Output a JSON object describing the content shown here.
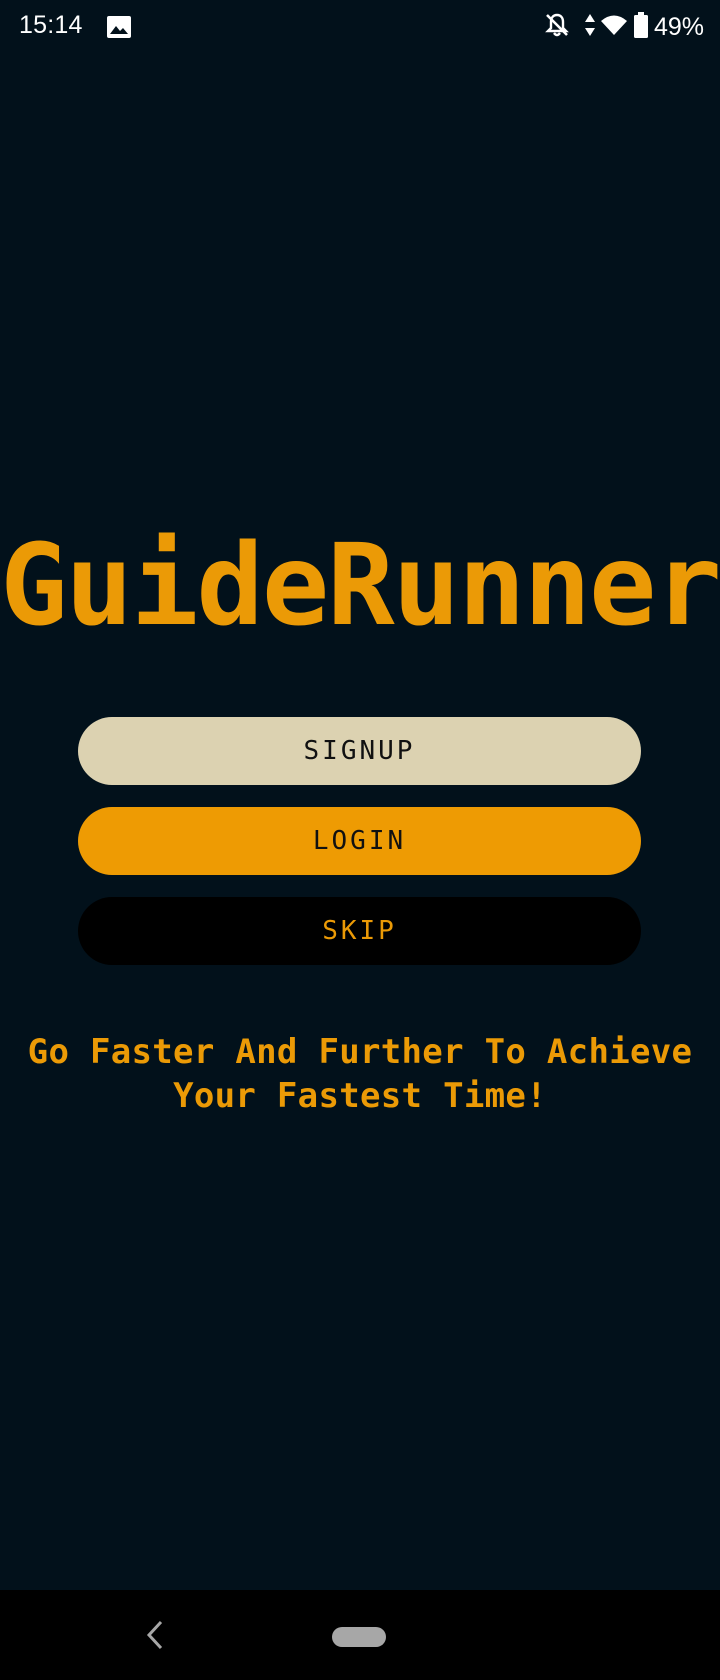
{
  "status_bar": {
    "time": "15:14",
    "battery_percent": "49%",
    "icons": [
      "gallery-icon",
      "notifications-off-icon",
      "data-arrows-icon",
      "wifi-icon",
      "battery-icon"
    ]
  },
  "app": {
    "title": "GuideRunner",
    "tagline": "Go Faster And Further To Achieve Your Fastest Time!"
  },
  "buttons": {
    "signup": "SIGNUP",
    "login": "LOGIN",
    "skip": "SKIP"
  },
  "colors": {
    "background": "#02111b",
    "accent": "#eb9a06",
    "signup_button": "#dcd2b1",
    "login_button": "#ee9b03",
    "skip_button": "#000000"
  },
  "nav_bar": {
    "icons": [
      "back-icon",
      "home-pill-icon"
    ]
  }
}
